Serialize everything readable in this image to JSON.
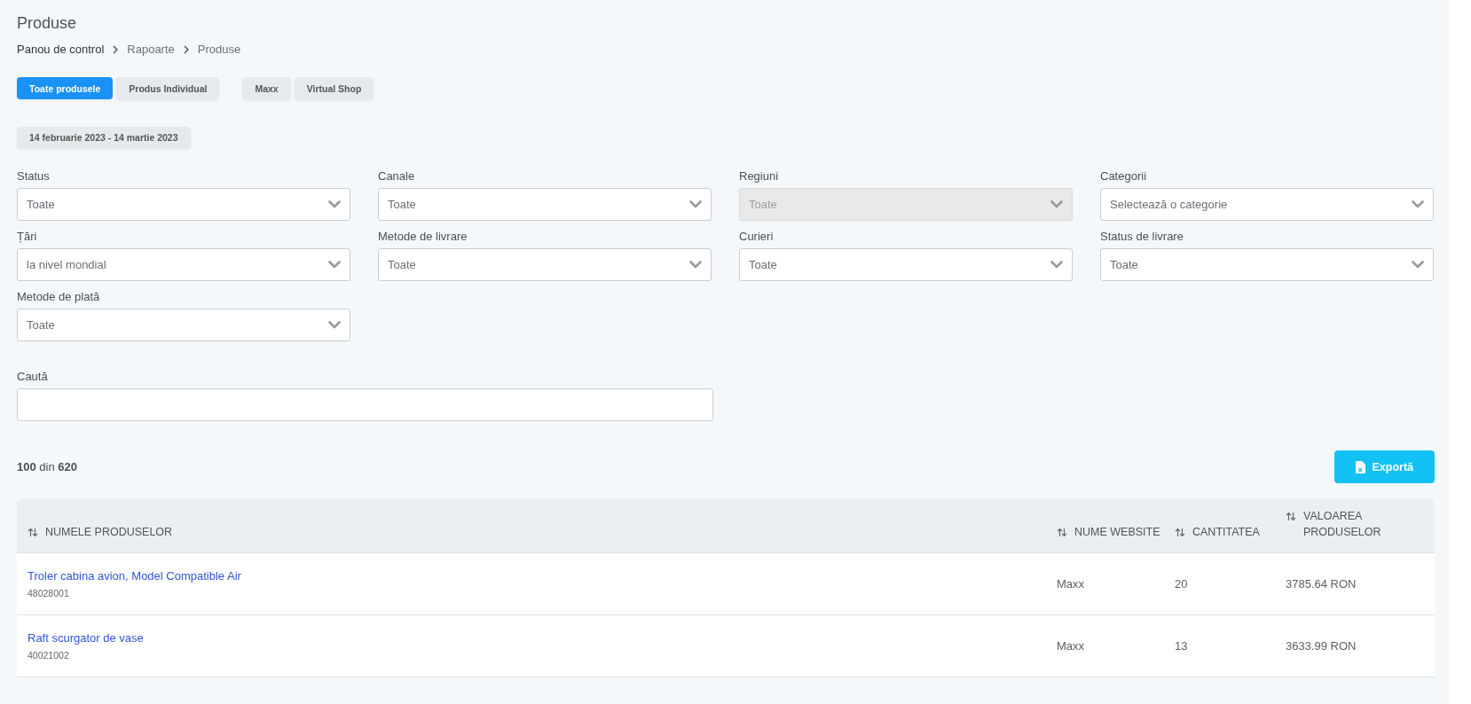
{
  "page": {
    "title": "Produse"
  },
  "breadcrumb": [
    "Panou de control",
    "Rapoarte",
    "Produse"
  ],
  "view_tabs": [
    {
      "label": "Toate produsele",
      "selected": true
    },
    {
      "label": "Produs Individual",
      "selected": false
    }
  ],
  "shop_tabs": [
    {
      "label": "Maxx",
      "selected": false
    },
    {
      "label": "Virtual Shop",
      "selected": false
    }
  ],
  "date_range": "14 februarie 2023 - 14 martie 2023",
  "filters": [
    {
      "label": "Status",
      "value": "Toate",
      "disabled": false
    },
    {
      "label": "Canale",
      "value": "Toate",
      "disabled": false
    },
    {
      "label": "Regiuni",
      "value": "Toate",
      "disabled": true
    },
    {
      "label": "Categorii",
      "value": "Selectează o categorie",
      "disabled": false
    },
    {
      "label": "Țări",
      "value": "la nivel mondial",
      "disabled": false
    },
    {
      "label": "Metode de livrare",
      "value": "Toate",
      "disabled": false
    },
    {
      "label": "Curieri",
      "value": "Toate",
      "disabled": false
    },
    {
      "label": "Status de livrare",
      "value": "Toate",
      "disabled": false
    },
    {
      "label": "Metode de plată",
      "value": "Toate",
      "disabled": false
    }
  ],
  "search": {
    "label": "Caută"
  },
  "count": "**100** din **620**",
  "export_button": "Exportă",
  "table": {
    "columns": [
      "NUMELE PRODUSELOR",
      "NUME WEBSITE",
      "CANTITATEA",
      "VALOAREA PRODUSELOR"
    ],
    "rows": [
      {
        "name": "Troler cabina avion, Model Compatible Air",
        "code": "48028001",
        "website": "Maxx",
        "quantity": "20",
        "value": "3785.64 RON"
      },
      {
        "name": "Raft scurgator de vase",
        "code": "40021002",
        "website": "Maxx",
        "quantity": "13",
        "value": "3633.99 RON"
      }
    ]
  }
}
